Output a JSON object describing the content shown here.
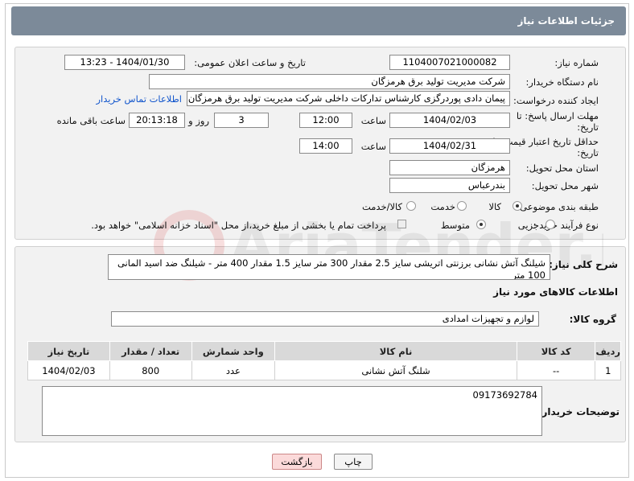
{
  "header": {
    "title": "جزئیات اطلاعات نیاز"
  },
  "fields": {
    "need_number_label": "شماره نیاز:",
    "need_number": "1104007021000082",
    "announce_label": "تاریخ و ساعت اعلان عمومی:",
    "announce_value": "1404/01/30 - 13:23",
    "buyer_org_label": "نام دستگاه خریدار:",
    "buyer_org": "شرکت مدیریت تولید برق هرمزگان",
    "creator_label": "ایجاد کننده درخواست:",
    "creator": "پیمان دادی پوردرگزی کارشناس تدارکات داخلی شرکت مدیریت تولید برق هرمزگان",
    "contact_link": "اطلاعات تماس خریدار",
    "deadline_label": "مهلت ارسال پاسخ: تا تاریخ:",
    "deadline_date": "1404/02/03",
    "time_label": "ساعت",
    "deadline_time": "12:00",
    "days_value": "3",
    "days_label": "روز و",
    "remaining_time": "20:13:18",
    "remaining_label": "ساعت باقی مانده",
    "min_validity_label": "حداقل تاریخ اعتبار قیمت: تا تاریخ:",
    "min_validity_date": "1404/02/31",
    "min_validity_time": "14:00",
    "province_label": "استان محل تحویل:",
    "province": "هرمزگان",
    "city_label": "شهر محل تحویل:",
    "city": "بندرعباس",
    "category_label": "طبقه بندی موضوعی:",
    "category_options": [
      "کالا",
      "خدمت",
      "کالا/خدمت"
    ],
    "process_label": "نوع فرآیند خرید :",
    "process_options": [
      "جزیی",
      "متوسط"
    ],
    "payment_note": "پرداخت تمام یا بخشی از مبلغ خرید،از محل \"اسناد خزانه اسلامی\" خواهد بود."
  },
  "description": {
    "label": "شرح کلی نیاز:",
    "text": "شیلنگ آتش نشانی برزنتی اتریشی سایز 2.5 مقدار 300 متر سایز 1.5 مقدار 400 متر - شیلنگ ضد اسید المانی 100 متر"
  },
  "goods": {
    "section_title": "اطلاعات کالاهای مورد نیاز",
    "group_label": "گروه کالا:",
    "group_value": "لوازم و تجهیزات امدادی",
    "columns": [
      "ردیف",
      "کد کالا",
      "نام کالا",
      "واحد شمارش",
      "تعداد / مقدار",
      "تاریخ نیاز"
    ],
    "rows": [
      [
        "1",
        "--",
        "شلنگ آتش نشانی",
        "عدد",
        "800",
        "1404/02/03"
      ]
    ]
  },
  "buyer_notes": {
    "label": "توضیحات خریدار:",
    "text": "09173692784"
  },
  "buttons": {
    "print": "چاپ",
    "back": "بازگشت"
  },
  "watermark": {
    "text": "AriaTender.neT"
  }
}
